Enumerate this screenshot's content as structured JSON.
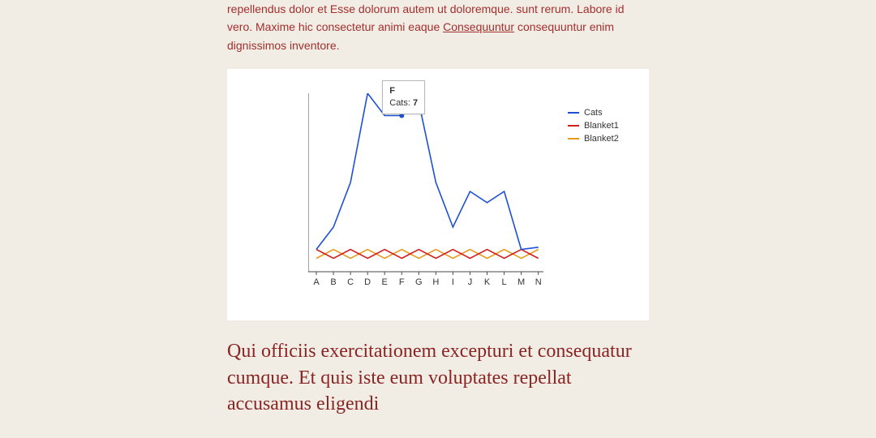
{
  "intro": {
    "text_before_link": "repellendus dolor et Esse dolorum autem ut doloremque. sunt rerum. Labore id vero. Maxime hic consectetur animi eaque ",
    "link_text": "Consequuntur",
    "text_after_link": " consequuntur enim dignissimos inventore."
  },
  "chart_data": {
    "type": "line",
    "categories": [
      "A",
      "B",
      "C",
      "D",
      "E",
      "F",
      "G",
      "H",
      "I",
      "J",
      "K",
      "L",
      "M",
      "N"
    ],
    "series": [
      {
        "name": "Cats",
        "values": [
          1.0,
          2.0,
          4.0,
          8.0,
          7.0,
          7.0,
          7.6,
          4.0,
          2.0,
          3.6,
          3.1,
          3.6,
          1.0,
          1.1
        ]
      },
      {
        "name": "Blanket1",
        "values": [
          1.0,
          0.6,
          1.0,
          0.6,
          1.0,
          0.6,
          1.0,
          0.6,
          1.0,
          0.6,
          1.0,
          0.6,
          1.0,
          0.6
        ]
      },
      {
        "name": "Blanket2",
        "values": [
          0.6,
          1.0,
          0.6,
          1.0,
          0.6,
          1.0,
          0.6,
          1.0,
          0.6,
          1.0,
          0.6,
          1.0,
          0.6,
          1.0
        ]
      }
    ],
    "ylim": [
      0,
      8
    ],
    "yticks": [
      0,
      2,
      4,
      6,
      8
    ],
    "xlabel": "",
    "ylabel": "",
    "title": "",
    "tooltip": {
      "category": "F",
      "series": "Cats",
      "value": "7"
    }
  },
  "legend": {
    "items": [
      {
        "label": "Cats"
      },
      {
        "label": "Blanket1"
      },
      {
        "label": "Blanket2"
      }
    ]
  },
  "heading": "Qui officiis exercitationem excepturi et consequatur cumque. Et quis iste eum voluptates repellat accusamus eligendi"
}
